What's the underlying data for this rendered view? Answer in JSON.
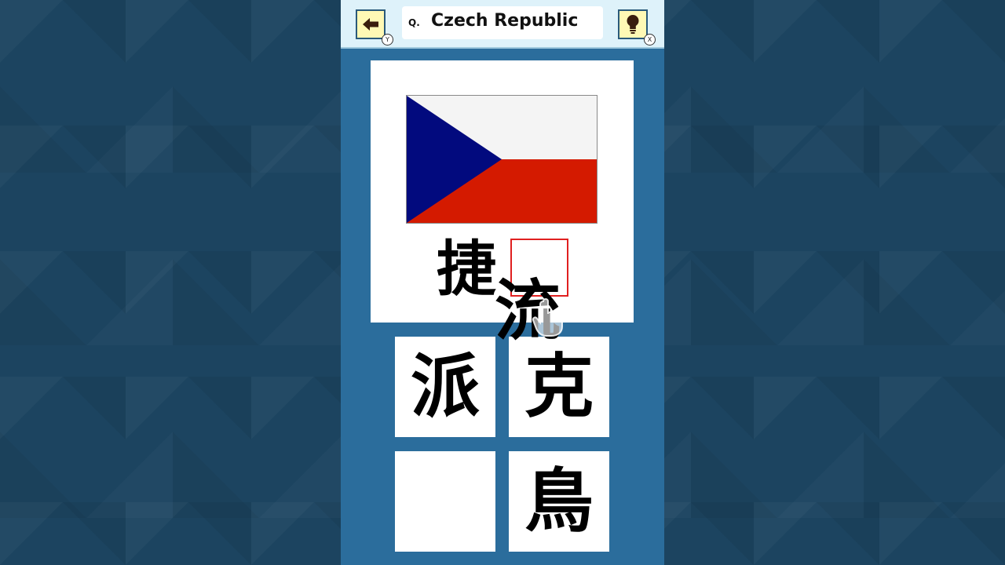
{
  "header": {
    "back_key": "Y",
    "hint_key": "X",
    "question_prefix": "Q.",
    "question": "Czech Republic"
  },
  "icons": {
    "back": "arrow-left-icon",
    "hint": "lightbulb-icon",
    "cursor": "hand-cursor-icon"
  },
  "question_card": {
    "flag": "czech-flag",
    "answer_char_1": "捷",
    "answer_slot_2": ""
  },
  "dragging_char": "流",
  "tiles": [
    "派",
    "克",
    "",
    "鳥"
  ],
  "colors": {
    "panel": "#2b6d9c",
    "topbar": "#def2fa",
    "button": "#fff9b5",
    "slot_border": "#e02020",
    "flag_white": "#f4f4f4",
    "flag_red": "#d41a00",
    "flag_blue": "#020a7e"
  }
}
